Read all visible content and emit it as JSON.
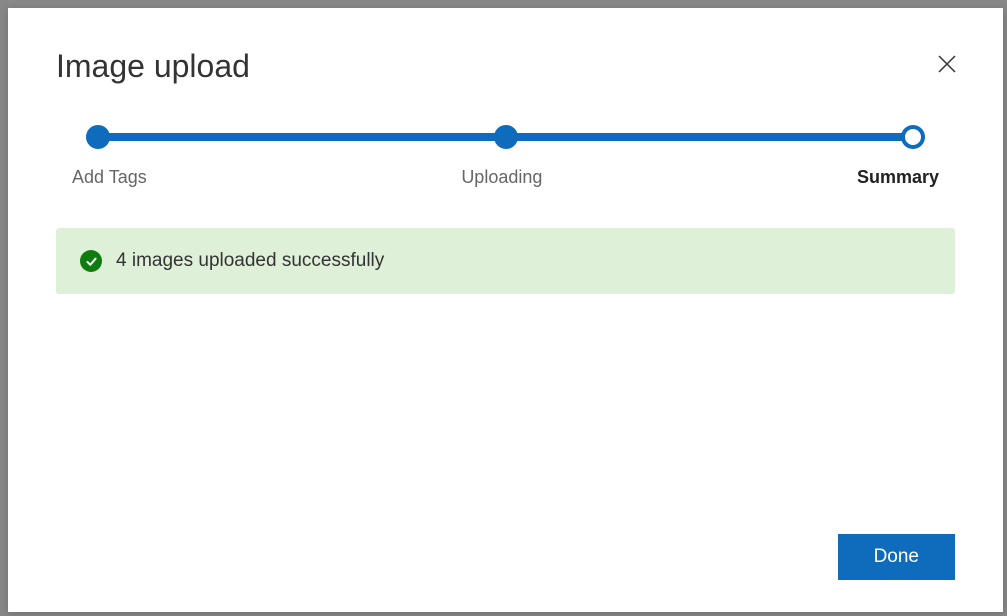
{
  "dialog": {
    "title": "Image upload"
  },
  "stepper": {
    "steps": [
      {
        "label": "Add Tags",
        "state": "complete"
      },
      {
        "label": "Uploading",
        "state": "complete"
      },
      {
        "label": "Summary",
        "state": "current"
      }
    ]
  },
  "status": {
    "message": "4 images uploaded successfully",
    "type": "success"
  },
  "actions": {
    "done_label": "Done"
  }
}
